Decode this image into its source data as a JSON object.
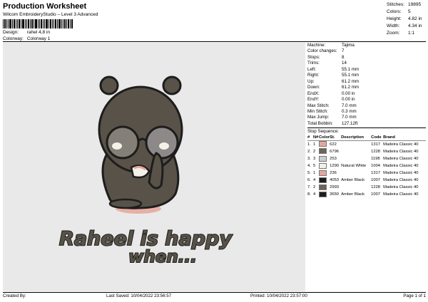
{
  "header": {
    "title": "Production Worksheet",
    "subtitle": "Wilcom EmbroideryStudio – Level 3 Advanced",
    "design_label": "Design:",
    "design_value": "rahel 4,8 in",
    "colorway_label": "Colorway:",
    "colorway_value": "Colorway 1"
  },
  "top_stats": [
    {
      "label": "Stitches:",
      "value": "19895"
    },
    {
      "label": "Colors:",
      "value": "5"
    },
    {
      "label": "Height:",
      "value": "4.82 in"
    },
    {
      "label": "Width:",
      "value": "4.34 in"
    },
    {
      "label": "Zoom:",
      "value": "1:1"
    }
  ],
  "machine_info": [
    {
      "label": "Machine:",
      "value": "Tajima"
    },
    {
      "label": "Color changes:",
      "value": "7"
    },
    {
      "label": "Stops:",
      "value": "8"
    },
    {
      "label": "Trims:",
      "value": "14"
    },
    {
      "label": "Left:",
      "value": "55.1 mm"
    },
    {
      "label": "Right:",
      "value": "55.1 mm"
    },
    {
      "label": "Up:",
      "value": "61.2 mm"
    },
    {
      "label": "Down:",
      "value": "61.2 mm"
    },
    {
      "label": "EndX:",
      "value": "0.00 in"
    },
    {
      "label": "EndY:",
      "value": "0.00 in"
    },
    {
      "label": "Max Stitch:",
      "value": "7.0 mm"
    },
    {
      "label": "Min Stitch:",
      "value": "0.3 mm"
    },
    {
      "label": "Max Jump:",
      "value": "7.0 mm"
    },
    {
      "label": "Total Bobbin:",
      "value": "127.12ft"
    }
  ],
  "stop_sequence": {
    "title": "Stop Sequence:",
    "headers": [
      "#",
      "N#",
      "Color",
      "St.",
      "Description",
      "Code",
      "Brand"
    ],
    "rows": [
      {
        "num": "1.",
        "n": "1",
        "color": "#e7a59a",
        "st": "622",
        "desc": "",
        "code": "1317",
        "brand": "Madeira Classic 40"
      },
      {
        "num": "2.",
        "n": "2",
        "color": "#6d6357",
        "st": "6796",
        "desc": "",
        "code": "1228",
        "brand": "Madeira Classic 40"
      },
      {
        "num": "3.",
        "n": "3",
        "color": "#cbcdd6",
        "st": "253",
        "desc": "",
        "code": "1198",
        "brand": "Madeira Classic 40"
      },
      {
        "num": "4.",
        "n": "5",
        "color": "#f2f1ea",
        "st": "1290",
        "desc": "Natural White",
        "code": "1004",
        "brand": "Madeira Classic 40"
      },
      {
        "num": "5.",
        "n": "1",
        "color": "#e7a59a",
        "st": "236",
        "desc": "",
        "code": "1317",
        "brand": "Madeira Classic 40"
      },
      {
        "num": "6.",
        "n": "4",
        "color": "#1d1d1d",
        "st": "4053",
        "desc": "Amber Black",
        "code": "1007",
        "brand": "Madeira Classic 40"
      },
      {
        "num": "7.",
        "n": "2",
        "color": "#6d6357",
        "st": "2993",
        "desc": "",
        "code": "1228",
        "brand": "Madeira Classic 40"
      },
      {
        "num": "8.",
        "n": "4",
        "color": "#1d1d1d",
        "st": "3650",
        "desc": "Amber Black",
        "code": "1007",
        "brand": "Madeira Classic 40"
      }
    ]
  },
  "artwork": {
    "line1": "Raheel is happy",
    "line2": "when...",
    "fill_color": "#595248",
    "outline_color": "#1d1d1d",
    "cheek_color": "#e7a59a",
    "lens_color": "#cbcdd6",
    "background_color": "#e9e9e9"
  },
  "footer": {
    "created_by": "Created By:",
    "last_saved": "Last Saved: 10/04/2022 23:56:57",
    "printed": "Printed: 10/04/2022 23:57:00",
    "page": "Page 1 of 1"
  }
}
